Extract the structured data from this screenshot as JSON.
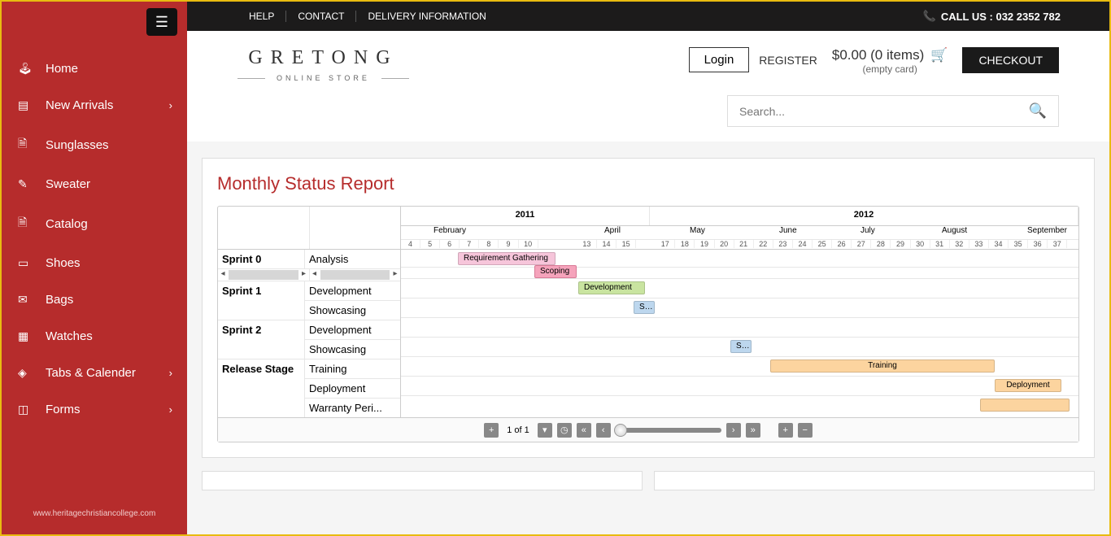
{
  "topbar": {
    "help": "HELP",
    "contact": "CONTACT",
    "delivery": "DELIVERY INFORMATION",
    "call_label": "CALL US : 032 2352 782"
  },
  "sidebar": {
    "items": [
      {
        "label": "Home",
        "icon": "dashboard-icon",
        "chevron": false
      },
      {
        "label": "New Arrivals",
        "icon": "tag-icon",
        "chevron": true
      },
      {
        "label": "Sunglasses",
        "icon": "file-icon",
        "chevron": false
      },
      {
        "label": "Sweater",
        "icon": "pencil-icon",
        "chevron": false
      },
      {
        "label": "Catalog",
        "icon": "file-icon",
        "chevron": false
      },
      {
        "label": "Shoes",
        "icon": "tablet-icon",
        "chevron": false
      },
      {
        "label": "Bags",
        "icon": "mail-icon",
        "chevron": false
      },
      {
        "label": "Watches",
        "icon": "grid-icon",
        "chevron": false
      },
      {
        "label": "Tabs & Calender",
        "icon": "layers-icon",
        "chevron": true
      },
      {
        "label": "Forms",
        "icon": "chart-icon",
        "chevron": true
      }
    ],
    "footer": "www.heritagechristiancollege.com"
  },
  "header": {
    "logo_title": "GRETONG",
    "logo_sub": "ONLINE STORE",
    "login": "Login",
    "register": "REGISTER",
    "cart_amount": "$0.00 (0 items)",
    "cart_empty": "(empty card)",
    "checkout": "CHECKOUT",
    "search_placeholder": "Search..."
  },
  "panel": {
    "title": "Monthly Status Report"
  },
  "gantt": {
    "left_rows": [
      {
        "name": "Sprint 0",
        "tasks": [
          "Analysis"
        ]
      },
      {
        "name": "Sprint 1",
        "tasks": [
          "Development",
          "Showcasing"
        ]
      },
      {
        "name": "Sprint 2",
        "tasks": [
          "Development",
          "Showcasing"
        ]
      },
      {
        "name": "Release Stage",
        "tasks": [
          "Training",
          "Deployment",
          "Warranty Peri..."
        ]
      }
    ],
    "years": [
      "2011",
      "2012"
    ],
    "months": [
      "February",
      "April",
      "May",
      "June",
      "July",
      "August",
      "September"
    ],
    "weeks": [
      "4",
      "5",
      "6",
      "7",
      "8",
      "9",
      "10",
      "",
      "",
      "13",
      "14",
      "15",
      "",
      "17",
      "18",
      "19",
      "20",
      "21",
      "22",
      "23",
      "24",
      "25",
      "26",
      "27",
      "28",
      "29",
      "30",
      "31",
      "32",
      "33",
      "34",
      "35",
      "36",
      "37"
    ],
    "bars": {
      "requirement": "Requirement Gathering",
      "scoping": "Scoping",
      "development": "Development",
      "showcasing1": "Sh...",
      "showcasing2": "Sh...",
      "training": "Training",
      "deployment": "Deployment"
    },
    "pager": "1 of 1"
  },
  "icons": {
    "hamburger": "☰",
    "dashboard": "📊",
    "tag": "🏷",
    "file": "📄",
    "pencil": "✎",
    "tablet": "▭",
    "mail": "✉",
    "grid": "▦",
    "layers": "◈",
    "chart": "📈",
    "chevron": "›",
    "phone": "📞",
    "cart": "🛒",
    "search": "🔍",
    "plus": "+",
    "down": "▾",
    "clock": "◷",
    "dleft": "«",
    "left": "‹",
    "right": "›",
    "dright": "»",
    "minus": "−"
  }
}
